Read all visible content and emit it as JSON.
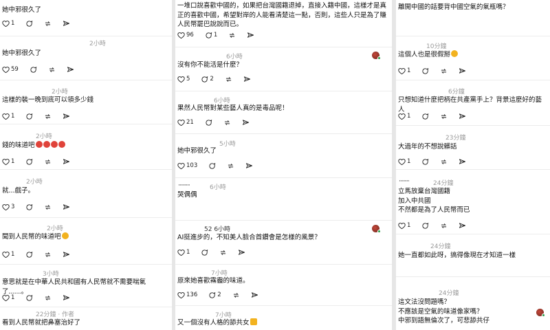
{
  "col1": [
    {
      "time": "",
      "text": "她中邪很久了",
      "likes": "1"
    },
    {
      "time": "2小時",
      "text": "她中邪很久了",
      "likes": "59"
    },
    {
      "time": "2小時",
      "text": "這樣的裝一晚到底可以領多少錢",
      "likes": "1"
    },
    {
      "time": "2小時",
      "text": "錢的味道吧",
      "likes": "1"
    },
    {
      "time": "2小時",
      "text": "就...戲子。",
      "likes": "3"
    },
    {
      "time": "2小時",
      "text": "聞到人民幣的味道吧",
      "likes": "1"
    },
    {
      "time": "3小時",
      "text": "意思就是在中華人民共和國有人民幣就不需要喘氣了......。",
      "likes": "1"
    },
    {
      "time": "22分鐘 · 作者",
      "text": "看到人民幣就把鼻塞治好了",
      "likes": ""
    }
  ],
  "col2": [
    {
      "time": "",
      "text": "一堆口說喜歡中國的，如果把台灣國籍退掉，直接入籍中國，這樣才是真正的喜歡中國，希望對岸的人能看清楚這一點，否則，這些人只是為了賺人民幣罷巴說說而已。",
      "likes": "96",
      "replies": "1"
    },
    {
      "time": "6小時",
      "text": "沒有你不能活是什麼？",
      "likes": "5",
      "replies": "2"
    },
    {
      "time": "6小時",
      "text": "果然人民幣對某些藝人真的是毒品呢！",
      "likes": "21",
      "replies": ""
    },
    {
      "time": "5小時",
      "text": "她中邪很久了",
      "likes": "103",
      "replies": ""
    },
    {
      "time": "6小時",
      "text": "哭偶偶",
      "likes": "",
      "replies": ""
    },
    {
      "time": "52 6小時",
      "text": "AI挺進步的，不知美人臉合首鑽會是怎樣的風景？",
      "likes": "1",
      "replies": ""
    },
    {
      "time": "7小時",
      "text": "原來她喜歡霧霾的味道。",
      "likes": "136",
      "replies": "2"
    },
    {
      "time": "7小時",
      "text": "又一個沒有人格的舔共女",
      "likes": "",
      "replies": ""
    }
  ],
  "col3": [
    {
      "time": "",
      "text": "離開中國的話要背中國空氣的氣瓶嗎？",
      "likes": ""
    },
    {
      "time": "10分鐘",
      "text": "這個人也是很假掰",
      "likes": "1"
    },
    {
      "time": "6分鐘",
      "text": "只想知道什麼把柄在共產黨手上？背景這麼好的藝人",
      "likes": "1"
    },
    {
      "time": "23分鐘",
      "text": "大過年的不想說髒話",
      "likes": "1"
    },
    {
      "time": "24分鐘",
      "text": "立馬放棄台灣國籍\n加入中共國\n不然都是為了人民幣而已",
      "likes": "1"
    },
    {
      "time": "24分鐘",
      "text": "她一直都如此呀，搞得像現在才知道一樣",
      "likes": ""
    },
    {
      "time": "24分鐘",
      "text": "這文法沒問題嗎？\n不應該是空氣的味道像家嗎？\n中邪到語無倫次了，可悲舔共仔",
      "likes": ""
    }
  ],
  "colors": {
    "accent_emoji_red": "#e0433a",
    "accent_emoji_yellow": "#f2b21f",
    "meta_gray": "#9a9a9a"
  }
}
